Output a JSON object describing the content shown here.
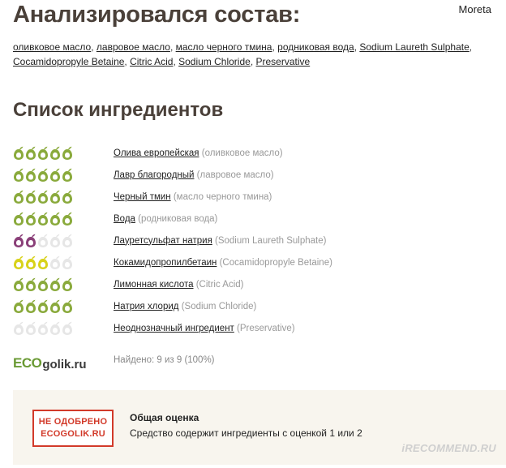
{
  "header": {
    "title": "Анализировался состав:",
    "author": "Moreta"
  },
  "analyzed_items": [
    "оливковое масло",
    "лавровое масло",
    "масло черного тмина",
    "родниковая вода",
    "Sodium Laureth Sulphate",
    "Cocamidopropyle Betaine",
    "Citric Acid",
    "Sodium Chloride",
    "Preservative"
  ],
  "ingredients_section": {
    "title": "Список ингредиентов",
    "items": [
      {
        "name": "Олива европейская",
        "original": "(оливковое масло)",
        "rating": 5,
        "color": "#8aaa3c"
      },
      {
        "name": "Лавр благородный",
        "original": "(лавровое масло)",
        "rating": 5,
        "color": "#8aaa3c"
      },
      {
        "name": "Черный тмин",
        "original": "(масло черного тмина)",
        "rating": 5,
        "color": "#8aaa3c"
      },
      {
        "name": "Вода",
        "original": "(родниковая вода)",
        "rating": 5,
        "color": "#8aaa3c"
      },
      {
        "name": "Лауретсульфат натрия",
        "original": "(Sodium Laureth Sulphate)",
        "rating": 2,
        "color": "#8a3f78"
      },
      {
        "name": "Кокамидопропилбетаин",
        "original": "(Cocamidopropyle Betaine)",
        "rating": 3,
        "color": "#d8d21a"
      },
      {
        "name": "Лимонная кислота",
        "original": "(Citric Acid)",
        "rating": 5,
        "color": "#8aaa3c"
      },
      {
        "name": "Натрия хлорид",
        "original": "(Sodium Chloride)",
        "rating": 5,
        "color": "#8aaa3c"
      },
      {
        "name": "Неоднозначный ингредиент",
        "original": "(Preservative)",
        "rating": 0,
        "color": "#8aaa3c"
      }
    ],
    "empty_color": "#e6e6e6"
  },
  "footer": {
    "logo_eco": "ECO",
    "logo_golik": "golik.ru",
    "found_text": "Найдено: 9 из 9 (100%)"
  },
  "verdict": {
    "stamp_line1": "НЕ ОДОБРЕНО",
    "stamp_line2": "ECOGOLIK.RU",
    "title": "Общая оценка",
    "text": "Средство содержит ингредиенты с оценкой 1 или 2",
    "watermark": "iRECOMMEND.RU"
  }
}
